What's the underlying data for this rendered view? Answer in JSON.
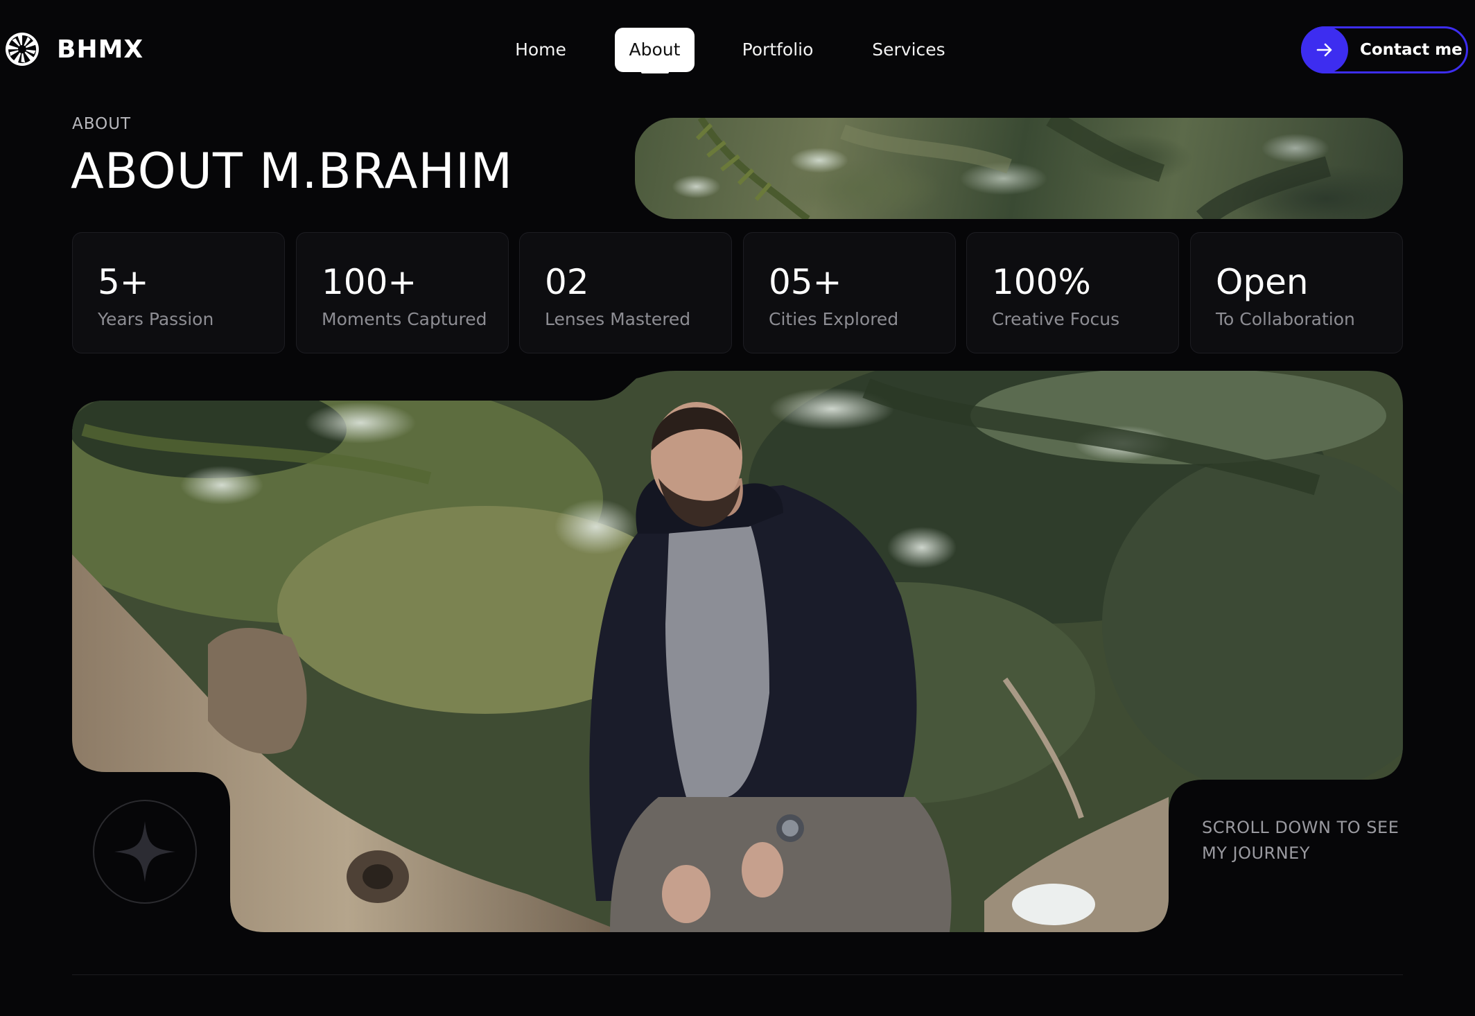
{
  "brand": {
    "name": "BHMX",
    "logo_icon": "aperture-icon"
  },
  "nav": {
    "items": [
      {
        "label": "Home",
        "active": false
      },
      {
        "label": "About",
        "active": true
      },
      {
        "label": "Portfolio",
        "active": false
      },
      {
        "label": "Services",
        "active": false
      }
    ],
    "contact_label": "Contact me",
    "contact_icon": "arrow-right-icon",
    "accent_color": "#3d2df0"
  },
  "header": {
    "eyebrow": "ABOUT",
    "title": "ABOUT M.BRAHIM"
  },
  "stats": [
    {
      "value": "5+",
      "label": "Years Passion"
    },
    {
      "value": "100+",
      "label": "Moments Captured"
    },
    {
      "value": "02",
      "label": "Lenses Mastered"
    },
    {
      "value": "05+",
      "label": "Cities Explored"
    },
    {
      "value": "100%",
      "label": "Creative Focus"
    },
    {
      "value": "Open",
      "label": "To Collaboration"
    }
  ],
  "hero": {
    "badge_icon": "four-point-star-icon",
    "scroll_note_line1": "SCROLL DOWN TO SEE",
    "scroll_note_line2": "MY JOURNEY"
  }
}
